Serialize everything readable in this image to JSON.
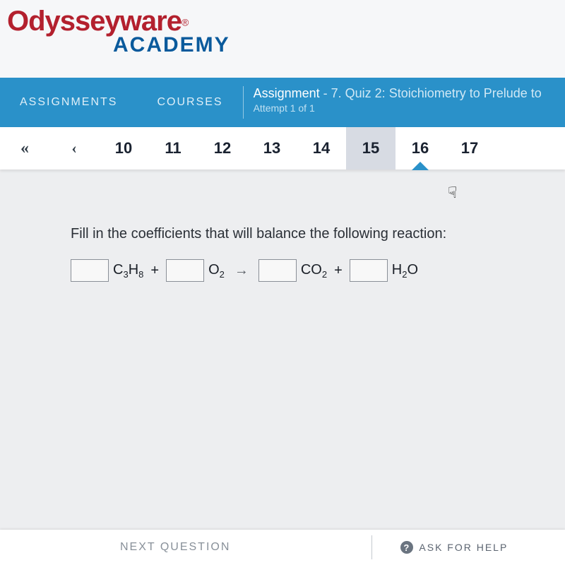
{
  "logo": {
    "line1": "Odysseyware",
    "reg": "®",
    "line2": "ACADEMY"
  },
  "nav": {
    "assignments": "ASSIGNMENTS",
    "courses": "COURSES",
    "assignment_label": "Assignment",
    "assignment_name": "- 7. Quiz 2: Stoichiometry to Prelude to",
    "attempt": "Attempt 1 of 1"
  },
  "pager": {
    "first_icon": "«",
    "prev_icon": "‹",
    "items": [
      "10",
      "11",
      "12",
      "13",
      "14",
      "15",
      "16",
      "17"
    ],
    "hover_index": 5,
    "current_index": 6
  },
  "question": {
    "prompt": "Fill in the coefficients that will balance the following reaction:",
    "species": {
      "a": "C3H8",
      "b": "O2",
      "c": "CO2",
      "d": "H2O"
    },
    "plus": "+",
    "arrow": "→"
  },
  "footer": {
    "next": "NEXT QUESTION",
    "ask": "ASK FOR HELP",
    "help_glyph": "?"
  },
  "cursor_glyph": "☟"
}
